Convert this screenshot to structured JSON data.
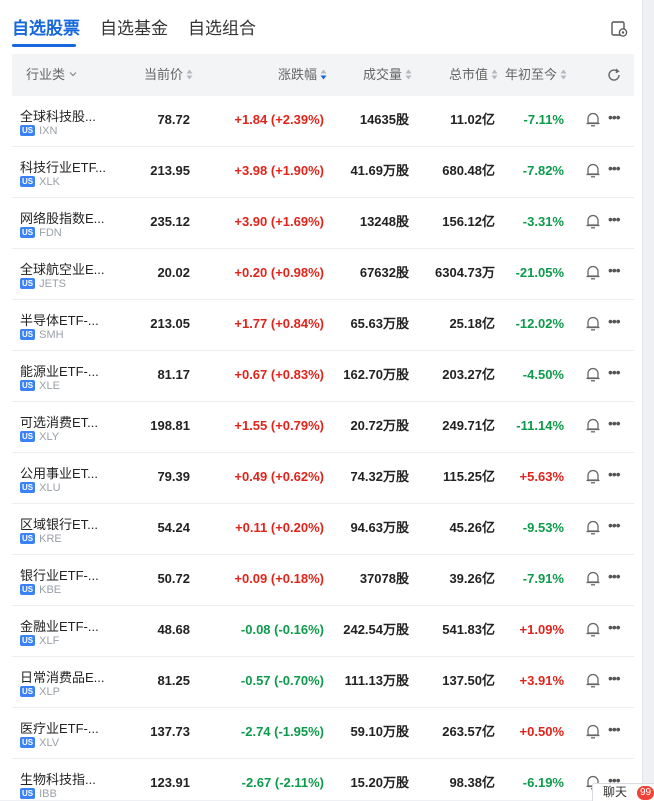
{
  "tabs": [
    {
      "label": "自选股票",
      "active": true
    },
    {
      "label": "自选基金",
      "active": false
    },
    {
      "label": "自选组合",
      "active": false
    }
  ],
  "header": {
    "industry": "行业类",
    "price": "当前价",
    "change": "涨跌幅",
    "volume": "成交量",
    "market_cap": "总市值",
    "ytd": "年初至今"
  },
  "colors": {
    "accent": "#1668dc",
    "up": "#e1241b",
    "down": "#0e9a4b",
    "us_badge": "#3b82f6"
  },
  "market_badge": "US",
  "rows": [
    {
      "name": "全球科技股...",
      "ticker": "IXN",
      "price": "78.72",
      "change": "+1.84 (+2.39%)",
      "change_dir": "up",
      "volume": "14635股",
      "market_cap": "11.02亿",
      "ytd": "-7.11%",
      "ytd_dir": "down"
    },
    {
      "name": "科技行业ETF...",
      "ticker": "XLK",
      "price": "213.95",
      "change": "+3.98 (+1.90%)",
      "change_dir": "up",
      "volume": "41.69万股",
      "market_cap": "680.48亿",
      "ytd": "-7.82%",
      "ytd_dir": "down"
    },
    {
      "name": "网络股指数E...",
      "ticker": "FDN",
      "price": "235.12",
      "change": "+3.90 (+1.69%)",
      "change_dir": "up",
      "volume": "13248股",
      "market_cap": "156.12亿",
      "ytd": "-3.31%",
      "ytd_dir": "down"
    },
    {
      "name": "全球航空业E...",
      "ticker": "JETS",
      "price": "20.02",
      "change": "+0.20 (+0.98%)",
      "change_dir": "up",
      "volume": "67632股",
      "market_cap": "6304.73万",
      "ytd": "-21.05%",
      "ytd_dir": "down"
    },
    {
      "name": "半导体ETF-...",
      "ticker": "SMH",
      "price": "213.05",
      "change": "+1.77 (+0.84%)",
      "change_dir": "up",
      "volume": "65.63万股",
      "market_cap": "25.18亿",
      "ytd": "-12.02%",
      "ytd_dir": "down"
    },
    {
      "name": "能源业ETF-...",
      "ticker": "XLE",
      "price": "81.17",
      "change": "+0.67 (+0.83%)",
      "change_dir": "up",
      "volume": "162.70万股",
      "market_cap": "203.27亿",
      "ytd": "-4.50%",
      "ytd_dir": "down"
    },
    {
      "name": "可选消费ET...",
      "ticker": "XLY",
      "price": "198.81",
      "change": "+1.55 (+0.79%)",
      "change_dir": "up",
      "volume": "20.72万股",
      "market_cap": "249.71亿",
      "ytd": "-11.14%",
      "ytd_dir": "down"
    },
    {
      "name": "公用事业ET...",
      "ticker": "XLU",
      "price": "79.39",
      "change": "+0.49 (+0.62%)",
      "change_dir": "up",
      "volume": "74.32万股",
      "market_cap": "115.25亿",
      "ytd": "+5.63%",
      "ytd_dir": "up"
    },
    {
      "name": "区域银行ET...",
      "ticker": "KRE",
      "price": "54.24",
      "change": "+0.11 (+0.20%)",
      "change_dir": "up",
      "volume": "94.63万股",
      "market_cap": "45.26亿",
      "ytd": "-9.53%",
      "ytd_dir": "down"
    },
    {
      "name": "银行业ETF-...",
      "ticker": "KBE",
      "price": "50.72",
      "change": "+0.09 (+0.18%)",
      "change_dir": "up",
      "volume": "37078股",
      "market_cap": "39.26亿",
      "ytd": "-7.91%",
      "ytd_dir": "down"
    },
    {
      "name": "金融业ETF-...",
      "ticker": "XLF",
      "price": "48.68",
      "change": "-0.08 (-0.16%)",
      "change_dir": "down",
      "volume": "242.54万股",
      "market_cap": "541.83亿",
      "ytd": "+1.09%",
      "ytd_dir": "up"
    },
    {
      "name": "日常消费品E...",
      "ticker": "XLP",
      "price": "81.25",
      "change": "-0.57 (-0.70%)",
      "change_dir": "down",
      "volume": "111.13万股",
      "market_cap": "137.50亿",
      "ytd": "+3.91%",
      "ytd_dir": "up"
    },
    {
      "name": "医疗业ETF-...",
      "ticker": "XLV",
      "price": "137.73",
      "change": "-2.74 (-1.95%)",
      "change_dir": "down",
      "volume": "59.10万股",
      "market_cap": "263.57亿",
      "ytd": "+0.50%",
      "ytd_dir": "up"
    },
    {
      "name": "生物科技指...",
      "ticker": "IBB",
      "price": "123.91",
      "change": "-2.67 (-2.11%)",
      "change_dir": "down",
      "volume": "15.20万股",
      "market_cap": "98.38亿",
      "ytd": "-6.19%",
      "ytd_dir": "down"
    }
  ],
  "chat": {
    "label": "聊天",
    "badge": "99"
  }
}
